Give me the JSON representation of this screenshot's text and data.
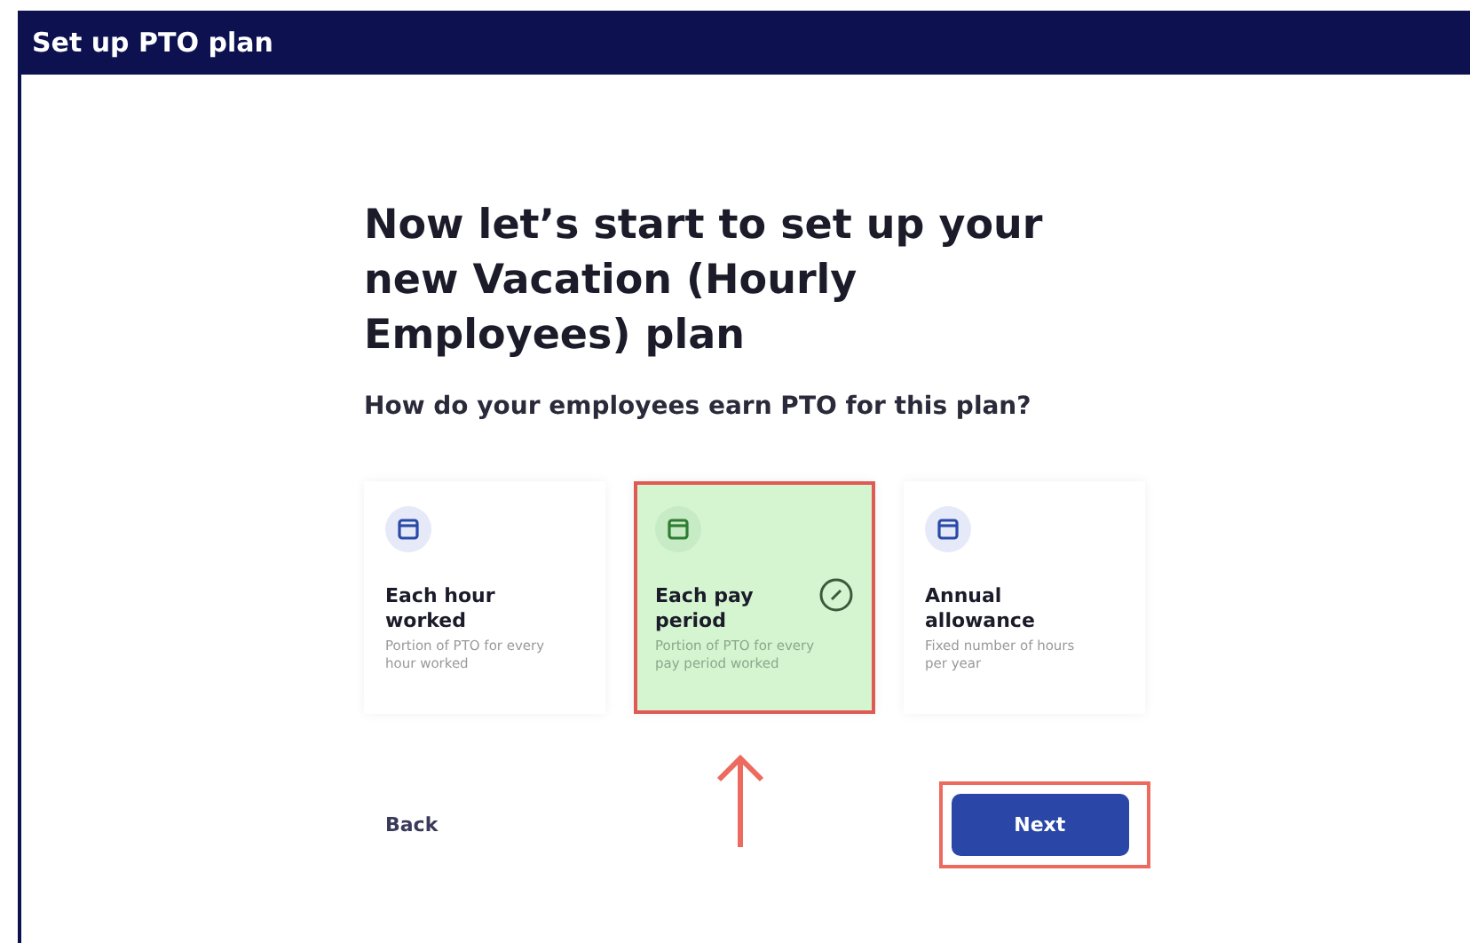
{
  "window": {
    "title": "Set up PTO plan"
  },
  "heading": "Now let’s start to set up your new Vacation (Hourly Employees) plan",
  "question": "How do your employees earn PTO for this plan?",
  "options": [
    {
      "title": "Each hour worked",
      "description": "Portion of PTO for every hour worked",
      "selected": false
    },
    {
      "title": "Each pay period",
      "description": "Portion of PTO for every pay period worked",
      "selected": true
    },
    {
      "title": "Annual allowance",
      "description": "Fixed number of hours per year",
      "selected": false
    }
  ],
  "buttons": {
    "back": "Back",
    "next": "Next"
  }
}
